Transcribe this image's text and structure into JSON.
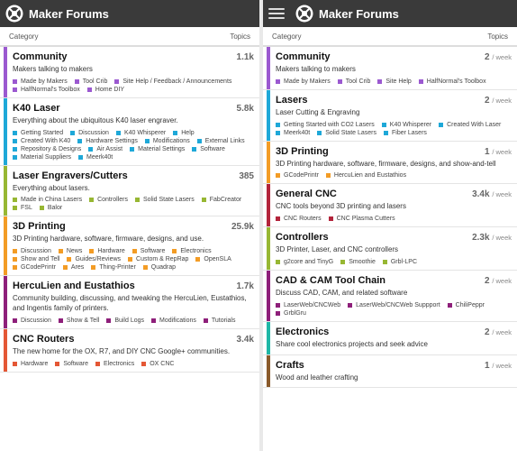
{
  "brand_name": "Maker Forums",
  "columns": {
    "category": "Category",
    "topics": "Topics"
  },
  "left_panel": {
    "categories": [
      {
        "title": "Community",
        "count": "1.1k",
        "color": "#9b59d0",
        "desc": "Makers talking to makers",
        "subs": [
          {
            "label": "Made by Makers",
            "color": "#9b59d0"
          },
          {
            "label": "Tool Crib",
            "color": "#9b59d0"
          },
          {
            "label": "Site Help / Feedback / Announcements",
            "color": "#9b59d0"
          },
          {
            "label": "HalfNormal's Toolbox",
            "color": "#9b59d0"
          },
          {
            "label": "Home DIY",
            "color": "#9b59d0"
          }
        ]
      },
      {
        "title": "K40 Laser",
        "count": "5.8k",
        "color": "#1ea8d8",
        "desc": "Everything about the ubiquitous K40 laser engraver.",
        "subs": [
          {
            "label": "Getting Started",
            "color": "#1ea8d8"
          },
          {
            "label": "Discussion",
            "color": "#1ea8d8"
          },
          {
            "label": "K40 Whisperer",
            "color": "#1ea8d8"
          },
          {
            "label": "Help",
            "color": "#1ea8d8"
          },
          {
            "label": "Created With K40",
            "color": "#1ea8d8"
          },
          {
            "label": "Hardware Settings",
            "color": "#1ea8d8"
          },
          {
            "label": "Modifications",
            "color": "#1ea8d8"
          },
          {
            "label": "External Links",
            "color": "#1ea8d8"
          },
          {
            "label": "Repository & Designs",
            "color": "#1ea8d8"
          },
          {
            "label": "Air Assist",
            "color": "#1ea8d8"
          },
          {
            "label": "Material Settings",
            "color": "#1ea8d8"
          },
          {
            "label": "Software",
            "color": "#1ea8d8"
          },
          {
            "label": "Material Suppliers",
            "color": "#1ea8d8"
          },
          {
            "label": "Meerk40t",
            "color": "#1ea8d8"
          }
        ]
      },
      {
        "title": "Laser Engravers/Cutters",
        "count": "385",
        "color": "#97b733",
        "desc": "Everything about lasers.",
        "subs": [
          {
            "label": "Made in China Lasers",
            "color": "#97b733"
          },
          {
            "label": "Controllers",
            "color": "#97b733"
          },
          {
            "label": "Solid State Lasers",
            "color": "#97b733"
          },
          {
            "label": "FabCreator",
            "color": "#97b733"
          },
          {
            "label": "FSL",
            "color": "#97b733"
          },
          {
            "label": "Balor",
            "color": "#97b733"
          }
        ]
      },
      {
        "title": "3D Printing",
        "count": "25.9k",
        "color": "#f39c25",
        "desc": "3D Printing hardware, software, firmware, designs, and use.",
        "subs": [
          {
            "label": "Discussion",
            "color": "#f39c25"
          },
          {
            "label": "News",
            "color": "#f39c25"
          },
          {
            "label": "Hardware",
            "color": "#f39c25"
          },
          {
            "label": "Software",
            "color": "#f39c25"
          },
          {
            "label": "Electronics",
            "color": "#f39c25"
          },
          {
            "label": "Show and Tell",
            "color": "#f39c25"
          },
          {
            "label": "Guides/Reviews",
            "color": "#f39c25"
          },
          {
            "label": "Custom & RepRap",
            "color": "#f39c25"
          },
          {
            "label": "OpenSLA",
            "color": "#f39c25"
          },
          {
            "label": "GCodePrintr",
            "color": "#f39c25"
          },
          {
            "label": "Ares",
            "color": "#f39c25"
          },
          {
            "label": "Thing-Printer",
            "color": "#f39c25"
          },
          {
            "label": "Quadrap",
            "color": "#f39c25"
          }
        ]
      },
      {
        "title": "HercuLien and Eustathios",
        "count": "1.7k",
        "color": "#8e1f7a",
        "desc": "Community building, discussing, and tweaking the HercuLien, Eustathios, and Ingentis family of printers.",
        "subs": [
          {
            "label": "Discussion",
            "color": "#8e1f7a"
          },
          {
            "label": "Show & Tell",
            "color": "#8e1f7a"
          },
          {
            "label": "Build Logs",
            "color": "#8e1f7a"
          },
          {
            "label": "Modifications",
            "color": "#8e1f7a"
          },
          {
            "label": "Tutorials",
            "color": "#8e1f7a"
          }
        ]
      },
      {
        "title": "CNC Routers",
        "count": "3.4k",
        "color": "#e45735",
        "desc": "The new home for the OX, R7, and DIY CNC Google+ communities.",
        "subs": [
          {
            "label": "Hardware",
            "color": "#e45735"
          },
          {
            "label": "Software",
            "color": "#e45735"
          },
          {
            "label": "Electronics",
            "color": "#e45735"
          },
          {
            "label": "OX CNC",
            "color": "#e45735"
          }
        ]
      }
    ]
  },
  "right_panel": {
    "per_week": "/ week",
    "categories": [
      {
        "title": "Community",
        "count": "2",
        "color": "#9b59d0",
        "desc": "Makers talking to makers",
        "subs": [
          {
            "label": "Made by Makers",
            "color": "#9b59d0"
          },
          {
            "label": "Tool Crib",
            "color": "#9b59d0"
          },
          {
            "label": "Site Help",
            "color": "#9b59d0"
          },
          {
            "label": "HalfNormal's Toolbox",
            "color": "#9b59d0"
          }
        ]
      },
      {
        "title": "Lasers",
        "count": "2",
        "color": "#1ea8d8",
        "desc": "Laser Cutting & Engraving",
        "subs": [
          {
            "label": "Getting Started with CO2 Lasers",
            "color": "#1ea8d8"
          },
          {
            "label": "K40 Whisperer",
            "color": "#1ea8d8"
          },
          {
            "label": "Created With Laser",
            "color": "#1ea8d8"
          },
          {
            "label": "Meerk40t",
            "color": "#1ea8d8"
          },
          {
            "label": "Solid State Lasers",
            "color": "#1ea8d8"
          },
          {
            "label": "Fiber Lasers",
            "color": "#1ea8d8"
          }
        ]
      },
      {
        "title": "3D Printing",
        "count": "1",
        "color": "#f39c25",
        "desc": "3D Printing hardware, software, firmware, designs, and show-and-tell",
        "subs": [
          {
            "label": "GCodePrintr",
            "color": "#f39c25"
          },
          {
            "label": "HercuLien and Eustathios",
            "color": "#f39c25"
          }
        ]
      },
      {
        "title": "General CNC",
        "count": "3.4k",
        "color": "#b3243b",
        "desc": "CNC tools beyond 3D printing and lasers",
        "subs": [
          {
            "label": "CNC Routers",
            "color": "#b3243b"
          },
          {
            "label": "CNC Plasma Cutters",
            "color": "#b3243b"
          }
        ]
      },
      {
        "title": "Controllers",
        "count": "2.3k",
        "color": "#97b733",
        "desc": "3D Printer, Laser, and CNC controllers",
        "subs": [
          {
            "label": "g2core and TinyG",
            "color": "#97b733"
          },
          {
            "label": "Smoothie",
            "color": "#97b733"
          },
          {
            "label": "Grbl-LPC",
            "color": "#97b733"
          }
        ]
      },
      {
        "title": "CAD & CAM Tool Chain",
        "count": "2",
        "color": "#8e1f7a",
        "desc": "Discuss CAD, CAM, and related software",
        "subs": [
          {
            "label": "LaserWeb/CNCWeb",
            "color": "#8e1f7a"
          },
          {
            "label": "LaserWeb/CNCWeb Suppport",
            "color": "#8e1f7a"
          },
          {
            "label": "ChiliPeppr",
            "color": "#8e1f7a"
          },
          {
            "label": "GrblGru",
            "color": "#8e1f7a"
          }
        ]
      },
      {
        "title": "Electronics",
        "count": "2",
        "color": "#1fb7a6",
        "desc": "Share cool electronics projects and seek advice",
        "subs": []
      },
      {
        "title": "Crafts",
        "count": "1",
        "color": "#8a5a2b",
        "desc": "Wood and leather crafting",
        "subs": []
      }
    ]
  }
}
